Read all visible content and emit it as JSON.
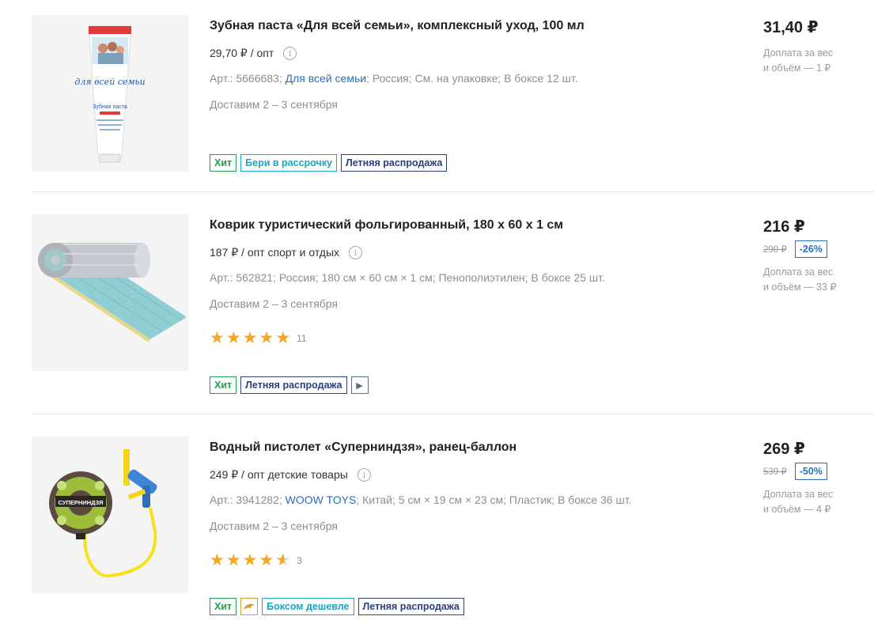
{
  "products": [
    {
      "title": "Зубная паста «Для всей семьи», комплексный уход, 100 мл",
      "opt_price": "29,70 ₽ / опт",
      "meta_sku": "Арт.: 5666683; ",
      "meta_brand": "Для всей семьи",
      "meta_rest": "; Россия; См. на упаковке; В боксе 12 шт.",
      "delivery": "Доставим 2 – 3 сентября",
      "badges": [
        "Хит",
        "Бери в рассрочку",
        "Летняя распродажа"
      ],
      "price": "31,40 ₽",
      "surcharge_line1": "Доплата за вес",
      "surcharge_line2": "и объём — 1 ₽",
      "package_brand": "для всей семьи",
      "package_type": "Зубная паста"
    },
    {
      "title": "Коврик туристический фольгированный, 180 х 60 х 1 см",
      "opt_price": "187 ₽ / опт спорт и отдых",
      "meta_text": "Арт.: 562821; Россия; 180 см × 60 см × 1 см; Пенополиэтилен; В боксе 25 шт.",
      "delivery": "Доставим 2 – 3 сентября",
      "rating": 5,
      "rating_count": "11",
      "badges": [
        "Хит",
        "Летняя распродажа"
      ],
      "price": "216 ₽",
      "old_price": "290 ₽",
      "discount": "-26%",
      "surcharge_line1": "Доплата за вес",
      "surcharge_line2": "и объём — 33 ₽"
    },
    {
      "title": "Водный пистолет «Суперниндзя», ранец-баллон",
      "opt_price": "249 ₽ / опт детские товары",
      "meta_sku": "Арт.: 3941282; ",
      "meta_brand": "WOOW TOYS",
      "meta_rest": "; Китай; 5 см × 19 см × 23 см; Пластик; В боксе 36 шт.",
      "delivery": "Доставим 2 – 3 сентября",
      "rating": 4.5,
      "rating_count": "3",
      "badges": [
        "Хит",
        "Боксом дешевле",
        "Летняя распродажа"
      ],
      "price": "269 ₽",
      "old_price": "539 ₽",
      "discount": "-50%",
      "surcharge_line1": "Доплата за вес",
      "surcharge_line2": "и объём — 4 ₽",
      "package_label": "СУПЕРНИНДЗЯ"
    }
  ],
  "icons": {
    "info": "info-circle-icon",
    "star": "star-icon",
    "video": "play-icon",
    "dolphin": "dolphin-icon"
  },
  "colors": {
    "hit": "#1e9e4a",
    "install": "#19a5c4",
    "sale": "#2b3f7f",
    "link": "#2a6fb8",
    "star": "#f5a623"
  }
}
